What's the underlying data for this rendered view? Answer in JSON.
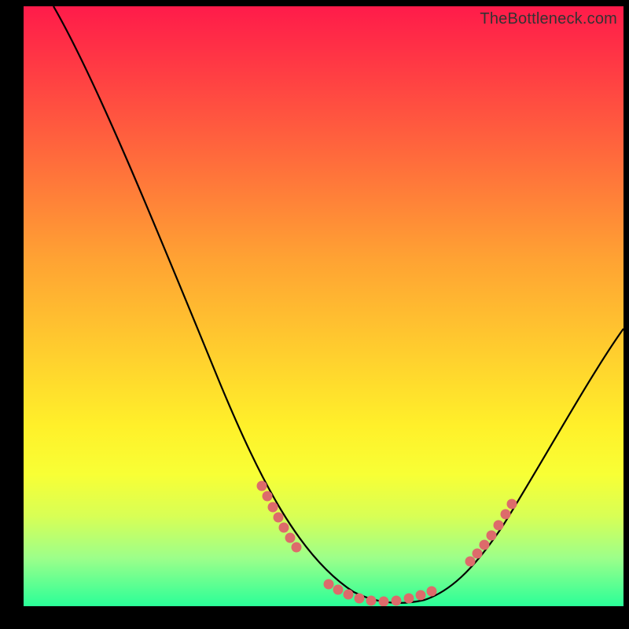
{
  "watermark": "TheBottleneck.com",
  "chart_data": {
    "type": "line",
    "title": "",
    "xlabel": "",
    "ylabel": "",
    "xlim": [
      0,
      100
    ],
    "ylim": [
      0,
      100
    ],
    "grid": false,
    "legend": false,
    "series": [
      {
        "name": "bottleneck-curve",
        "color": "#000000",
        "x": [
          5,
          10,
          15,
          20,
          25,
          30,
          35,
          40,
          45,
          50,
          53,
          56,
          59,
          62,
          65,
          68,
          72,
          76,
          80,
          84,
          88,
          92,
          96,
          100
        ],
        "y": [
          100,
          90,
          78,
          66,
          54,
          42,
          31,
          20,
          12,
          6,
          3,
          1,
          0,
          0,
          0,
          1,
          3,
          7,
          12,
          18,
          25,
          32,
          39,
          46
        ]
      }
    ],
    "highlighted_points": {
      "name": "curve-dots",
      "color": "#e06666",
      "left_cluster": {
        "x": [
          40,
          41,
          42,
          43,
          44,
          45
        ],
        "y": [
          19,
          17,
          15,
          13,
          12,
          10
        ]
      },
      "bottom_cluster": {
        "x": [
          50,
          52,
          54,
          56,
          58,
          60,
          62,
          64,
          66,
          68
        ],
        "y": [
          4,
          3,
          2,
          1,
          0,
          0,
          0,
          0,
          1,
          1
        ]
      },
      "right_cluster": {
        "x": [
          74,
          75,
          76,
          77,
          78,
          79
        ],
        "y": [
          7,
          8,
          9,
          10,
          12,
          13
        ]
      }
    },
    "background_gradient": {
      "top": "#ff1b4a",
      "mid": "#fff02a",
      "bottom": "#2aff98"
    }
  }
}
